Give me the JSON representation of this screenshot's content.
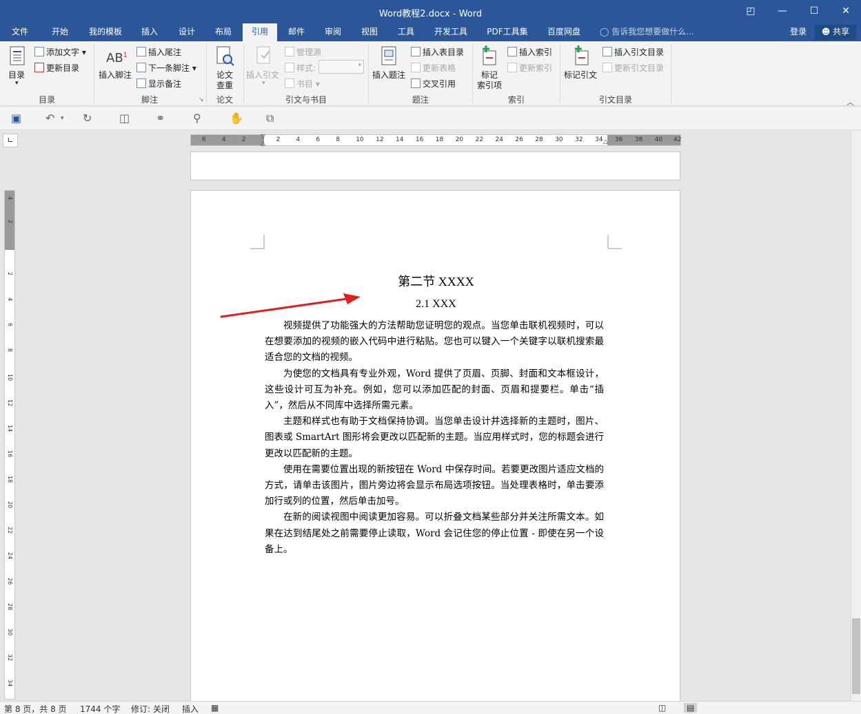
{
  "window": {
    "title": "Word教程2.docx - Word",
    "buttons": [
      "◰",
      "—",
      "☐",
      "✕"
    ]
  },
  "menu": {
    "tabs": [
      "文件",
      "开始",
      "我的模板",
      "插入",
      "设计",
      "布局",
      "引用",
      "邮件",
      "审阅",
      "视图",
      "工具",
      "开发工具",
      "PDF工具集",
      "百度网盘"
    ],
    "active": "引用",
    "tell_me": "告诉我您想要做什么...",
    "login": "登录",
    "share": "共享"
  },
  "ribbon": {
    "toc": {
      "big": "目录",
      "add_text": "添加文字",
      "update": "更新目录",
      "label": "目录"
    },
    "footnote": {
      "insert_footnote": "插入脚注",
      "insert_endnote": "插入尾注",
      "next_footnote": "下一条脚注",
      "show_notes": "显示备注",
      "label": "脚注"
    },
    "thesis": {
      "check": "论文",
      "check2": "查重",
      "label": "论文"
    },
    "citations": {
      "insert_citation": "插入引文",
      "manage_sources": "管理源",
      "style": "样式:",
      "bibliography": "书目",
      "label": "引文与书目"
    },
    "captions": {
      "insert_caption": "插入题注",
      "insert_tof": "插入表目录",
      "update_table": "更新表格",
      "cross_ref": "交叉引用",
      "label": "题注"
    },
    "index": {
      "mark_entry": "标记",
      "mark_entry2": "索引项",
      "insert_index": "插入索引",
      "update_index": "更新索引",
      "label": "索引"
    },
    "toa": {
      "mark_citation": "标记引文",
      "insert_toa": "插入引文目录",
      "update_toa": "更新引文目录",
      "label": "引文目录"
    }
  },
  "ruler": {
    "h_labels": [
      "6",
      "4",
      "2",
      "2",
      "4",
      "6",
      "8",
      "10",
      "12",
      "14",
      "16",
      "18",
      "20",
      "22",
      "24",
      "26",
      "28",
      "30",
      "32",
      "34",
      "36",
      "38",
      "40",
      "42"
    ],
    "v_labels": [
      "4",
      "2",
      "2",
      "4",
      "6",
      "8",
      "10",
      "12",
      "14",
      "16",
      "18",
      "20",
      "22",
      "24",
      "26",
      "28",
      "30",
      "32",
      "34"
    ]
  },
  "document": {
    "heading1": "第二节  XXXX",
    "heading2": "2.1 XXX",
    "paragraphs": [
      "视频提供了功能强大的方法帮助您证明您的观点。当您单击联机视频时，可以在想要添加的视频的嵌入代码中进行粘贴。您也可以键入一个关键字以联机搜索最适合您的文档的视频。",
      "为使您的文档具有专业外观，Word 提供了页眉、页脚、封面和文本框设计，这些设计可互为补充。例如，您可以添加匹配的封面、页眉和提要栏。单击“插入”，然后从不同库中选择所需元素。",
      "主题和样式也有助于文档保持协调。当您单击设计并选择新的主题时，图片、图表或 SmartArt 图形将会更改以匹配新的主题。当应用样式时，您的标题会进行更改以匹配新的主题。",
      "使用在需要位置出现的新按钮在 Word 中保存时间。若要更改图片适应文档的方式，请单击该图片，图片旁边将会显示布局选项按钮。当处理表格时，单击要添加行或列的位置，然后单击加号。",
      "在新的阅读视图中阅读更加容易。可以折叠文档某些部分并关注所需文本。如果在达到结尾处之前需要停止读取，Word 会记住您的停止位置 - 即使在另一个设备上。"
    ]
  },
  "status": {
    "page": "第 8 页，共 8 页",
    "words": "1744 个字",
    "track": "修订: 关闭",
    "mode": "插入"
  },
  "colors": {
    "accent": "#2b579a",
    "arrow": "#e02020"
  }
}
